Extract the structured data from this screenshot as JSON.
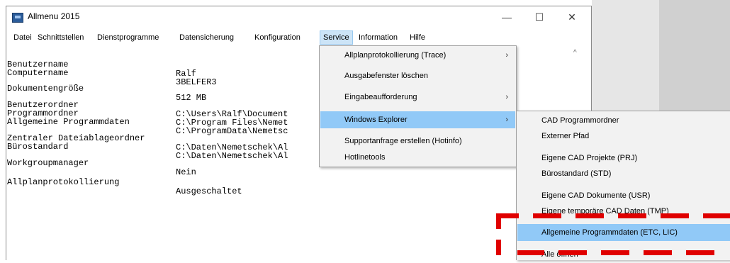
{
  "window": {
    "title": "Allmenu 2015",
    "minimize": "—",
    "maximize": "☐",
    "close": "✕"
  },
  "menubar": [
    "Datei",
    "Schnittstellen",
    "Dienstprogramme",
    "Datensicherung",
    "Konfiguration",
    "Service",
    "Information",
    "Hilfe"
  ],
  "info": {
    "benutzername": {
      "label": "Benutzername",
      "value": "Ralf"
    },
    "computername": {
      "label": "Computername",
      "value": "3BELFER3"
    },
    "dokumentengroesse": {
      "label": "Dokumentengröße",
      "value": "512 MB"
    },
    "benutzerordner": {
      "label": "Benutzerordner",
      "value": "C:\\Users\\Ralf\\Document"
    },
    "programmordner": {
      "label": "Programmordner",
      "value": "C:\\Program Files\\Nemet"
    },
    "programmdaten": {
      "label": "Allgemeine Programmdaten",
      "value": "C:\\ProgramData\\Nemetsc"
    },
    "zentraler": {
      "label": "Zentraler Dateiablageordner",
      "value": "C:\\Daten\\Nemetschek\\Al"
    },
    "buerostandard": {
      "label": "Bürostandard",
      "value": "C:\\Daten\\Nemetschek\\Al"
    },
    "workgroup": {
      "label": "Workgroupmanager",
      "value": "Nein"
    },
    "protokoll": {
      "label": "Allplanprotokollierung",
      "value": "Ausgeschaltet"
    }
  },
  "service_menu": [
    {
      "label": "Allplanprotokollierung (Trace)",
      "submenu": true
    },
    {
      "label": "Ausgabefenster löschen",
      "submenu": false
    },
    {
      "label": "Eingabeaufforderung",
      "submenu": true
    },
    {
      "label": "Windows Explorer",
      "submenu": true
    },
    {
      "label": "Supportanfrage erstellen (Hotinfo)",
      "submenu": false
    },
    {
      "label": "Hotlinetools",
      "submenu": false
    }
  ],
  "explorer_menu": [
    "CAD Programmordner",
    "Externer Pfad",
    "Eigene CAD Projekte (PRJ)",
    "Bürostandard (STD)",
    "Eigene CAD Dokumente (USR)",
    "Eigene temporäre CAD Daten (TMP)",
    "Allgemeine Programmdaten (ETC, LIC)",
    "Alle öffnen"
  ],
  "submenu_arrow": "›",
  "scroll_up": "^",
  "colors": {
    "highlight": "#91c9f7",
    "annotation": "#e00000",
    "menu_active": "#cce4f7"
  }
}
